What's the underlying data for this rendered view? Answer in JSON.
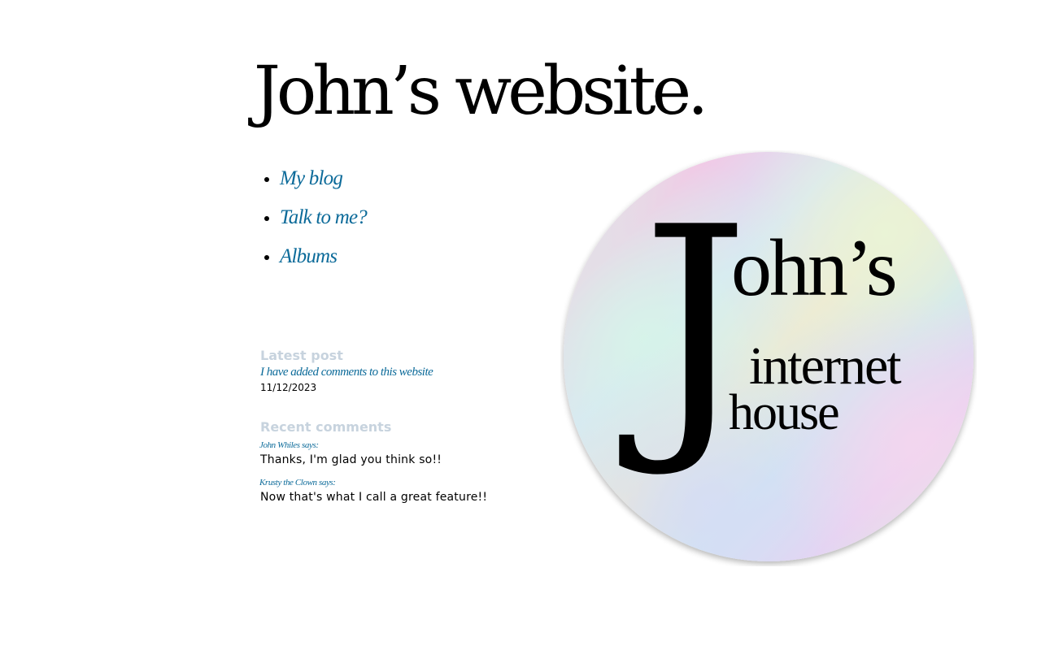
{
  "site": {
    "title": "John’s website."
  },
  "nav": {
    "items": [
      {
        "label": "My blog"
      },
      {
        "label": "Talk to me?"
      },
      {
        "label": "Albums"
      }
    ]
  },
  "latest_post": {
    "heading": "Latest post",
    "title": "I have added comments to this website",
    "date": "11/12/2023"
  },
  "recent_comments": {
    "heading": "Recent comments",
    "items": [
      {
        "author": "John Whiles",
        "says": " says:",
        "text": "Thanks, I'm glad you think so!!"
      },
      {
        "author": "Krusty the Clown",
        "says": " says:",
        "text": "Now that's what I call a great feature!!"
      }
    ]
  },
  "logo": {
    "big_letter": "J",
    "word_one": "ohn’s",
    "word_two": "internet",
    "word_three": "house"
  },
  "colors": {
    "link": "#0b6a99",
    "heading_muted": "#c7d3de",
    "text": "#000000"
  }
}
